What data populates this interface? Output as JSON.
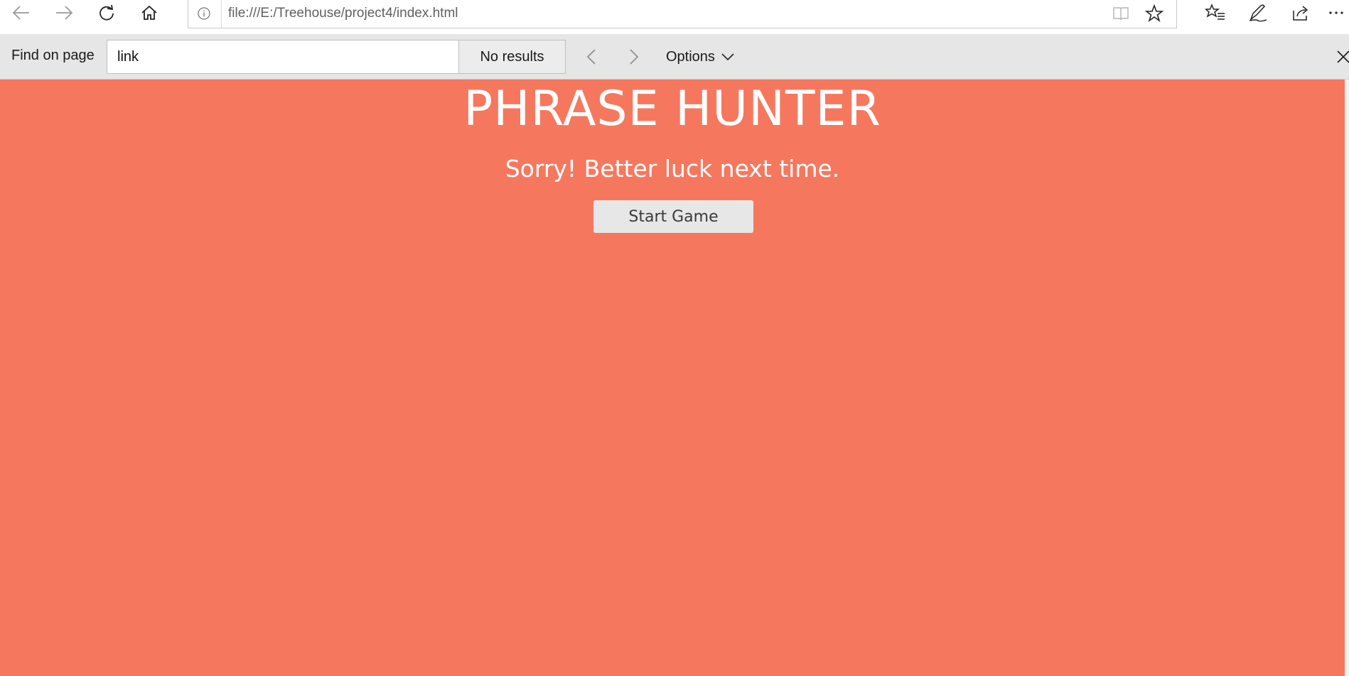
{
  "browser": {
    "url": "file:///E:/Treehouse/project4/index.html",
    "toolbar_icons": [
      "back-icon",
      "forward-icon",
      "refresh-icon",
      "home-icon",
      "info-icon",
      "reading-view-icon",
      "favorite-star-icon",
      "favorites-list-icon",
      "notes-pen-icon",
      "share-icon",
      "more-icon"
    ]
  },
  "find_bar": {
    "label": "Find on page",
    "query": "link",
    "results": "No results",
    "options_label": "Options"
  },
  "page": {
    "title": "PHRASE HUNTER",
    "message": "Sorry! Better luck next time.",
    "start_button_label": "Start Game",
    "colors": {
      "background": "#f5785e",
      "button": "#e7e7e7",
      "text": "#ffffff"
    }
  }
}
